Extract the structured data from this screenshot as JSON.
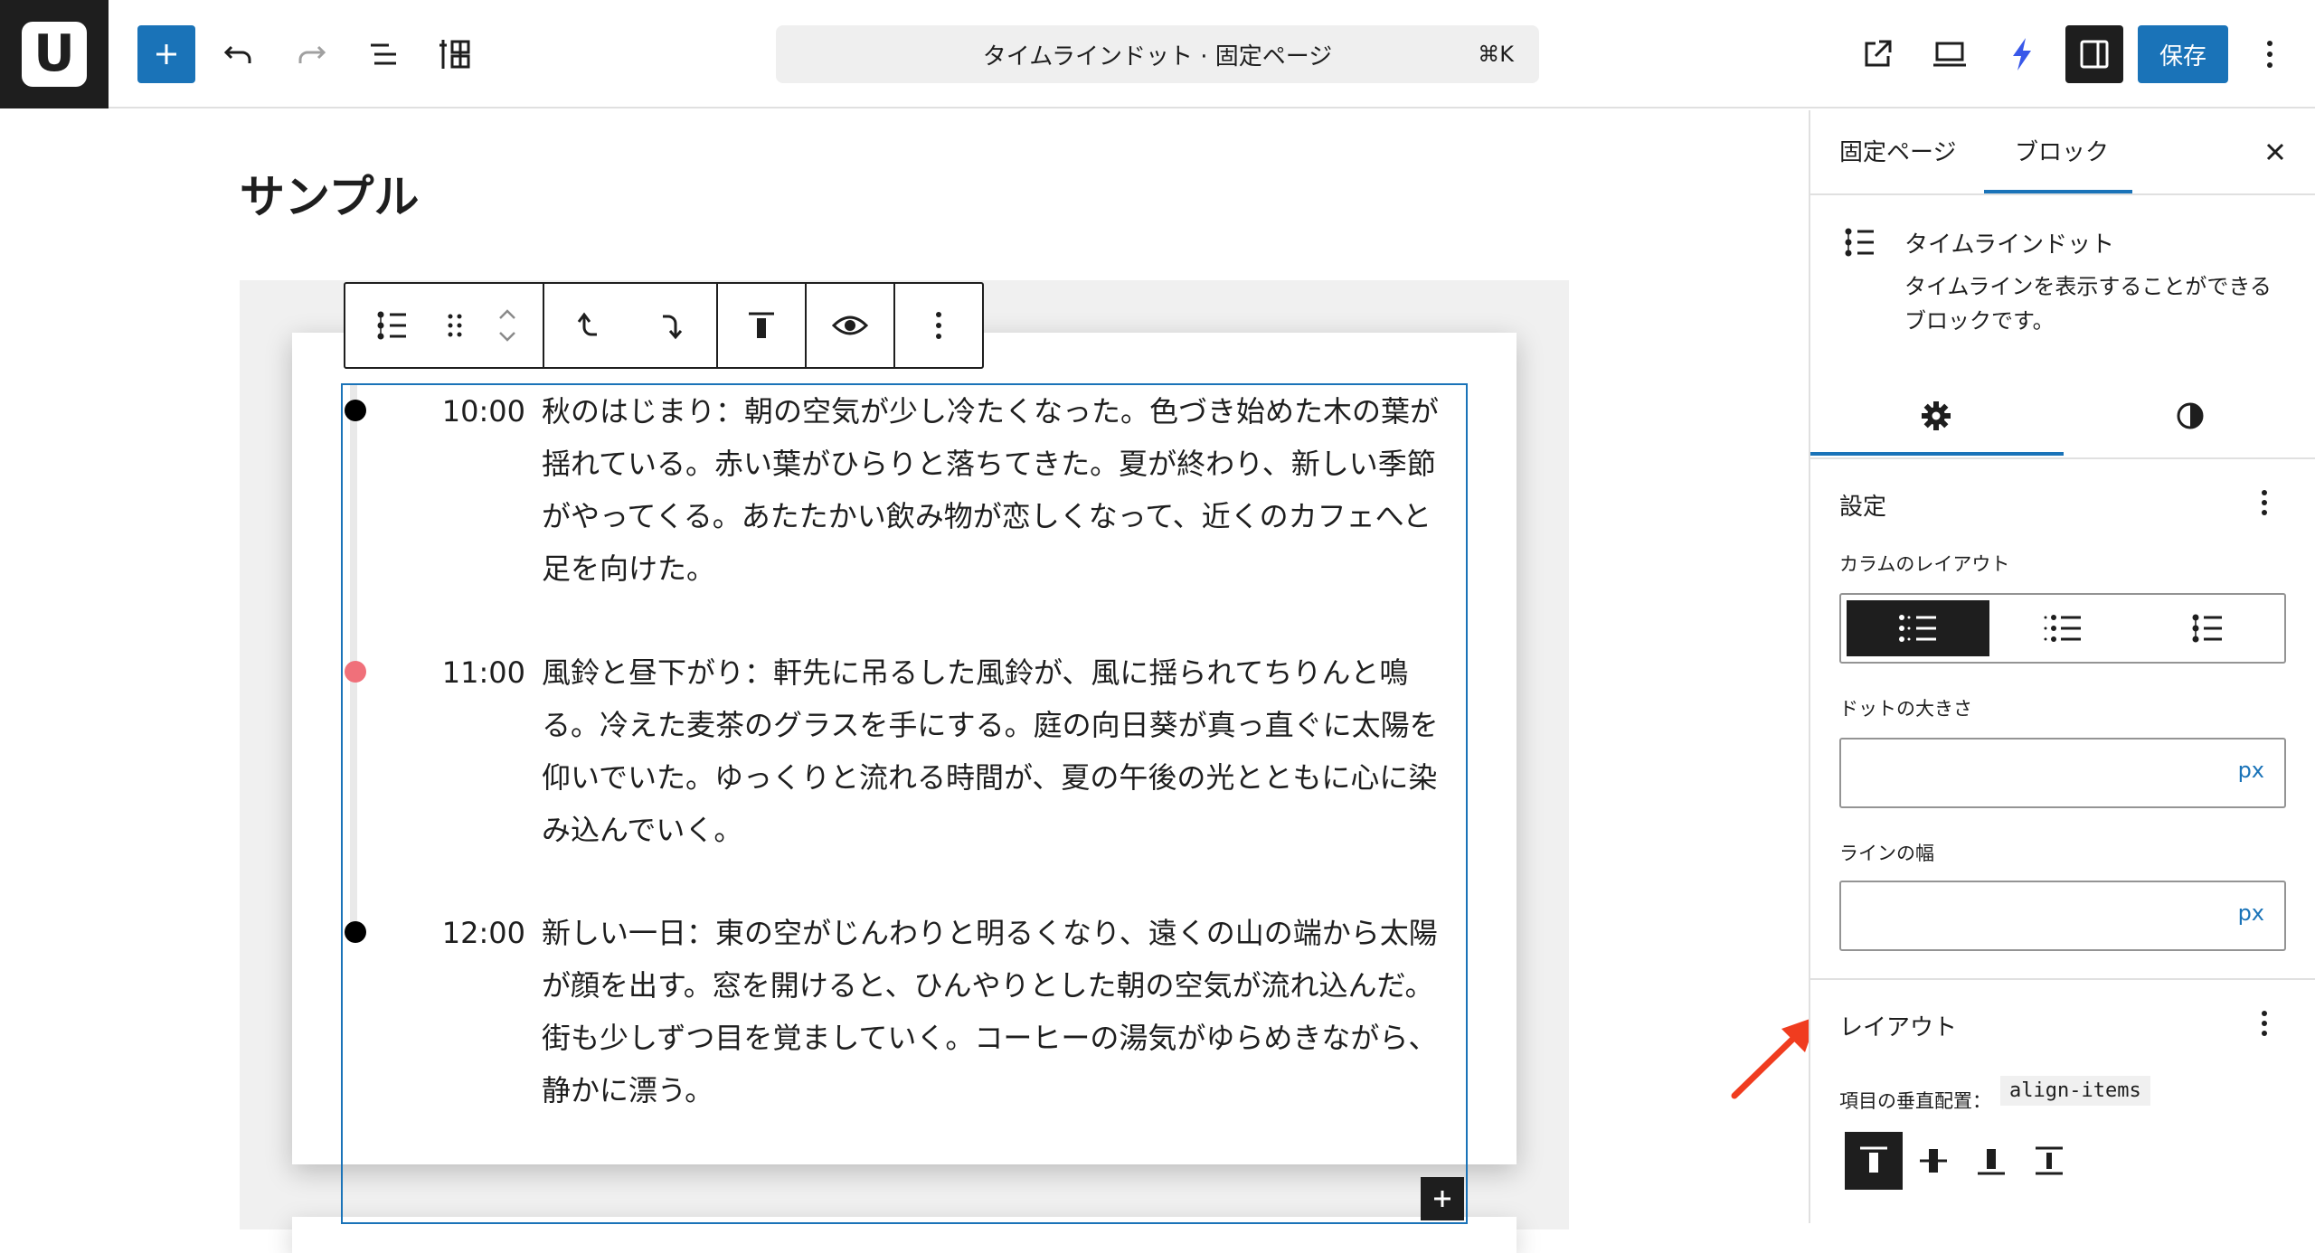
{
  "header": {
    "logo_letter": "U",
    "document_title": "タイムラインドット · 固定ページ",
    "command_shortcut": "⌘K",
    "save_label": "保存"
  },
  "canvas": {
    "page_title": "サンプル",
    "timeline": {
      "items": [
        {
          "time": "10:00",
          "text": "秋のはじまり：朝の空気が少し冷たくなった。色づき始めた木の葉が揺れている。赤い葉がひらりと落ちてきた。夏が終わり、新しい季節がやってくる。あたたかい飲み物が恋しくなって、近くのカフェへと足を向けた。",
          "dot_color": "#000000"
        },
        {
          "time": "11:00",
          "text": "風鈴と昼下がり：軒先に吊るした風鈴が、風に揺られてちりんと鳴る。冷えた麦茶のグラスを手にする。庭の向日葵が真っ直ぐに太陽を仰いでいた。ゆっくりと流れる時間が、夏の午後の光とともに心に染み込んでいく。",
          "dot_color": "#f0707a"
        },
        {
          "time": "12:00",
          "text": "新しい一日：東の空がじんわりと明るくなり、遠くの山の端から太陽が顔を出す。窓を開けると、ひんやりとした朝の空気が流れ込んだ。街も少しずつ目を覚ましていく。コーヒーの湯気がゆらめきながら、静かに漂う。",
          "dot_color": "#000000"
        }
      ]
    }
  },
  "sidebar": {
    "tabs": {
      "page": "固定ページ",
      "block": "ブロック"
    },
    "block_name": "タイムラインドット",
    "block_description": "タイムラインを表示することができるブロックです。",
    "settings_panel": {
      "title": "設定",
      "column_layout_label": "カラムのレイアウト",
      "dot_size_label": "ドットの大きさ",
      "dot_size_value": "",
      "dot_size_unit": "px",
      "line_width_label": "ラインの幅",
      "line_width_value": "",
      "line_width_unit": "px"
    },
    "layout_panel": {
      "title": "レイアウト",
      "vertical_align_label": "項目の垂直配置：",
      "vertical_align_code": "align-items"
    }
  },
  "colors": {
    "accent": "#1a73b8",
    "dark": "#1e1e1e",
    "annotation_arrow": "#f03c1f"
  }
}
